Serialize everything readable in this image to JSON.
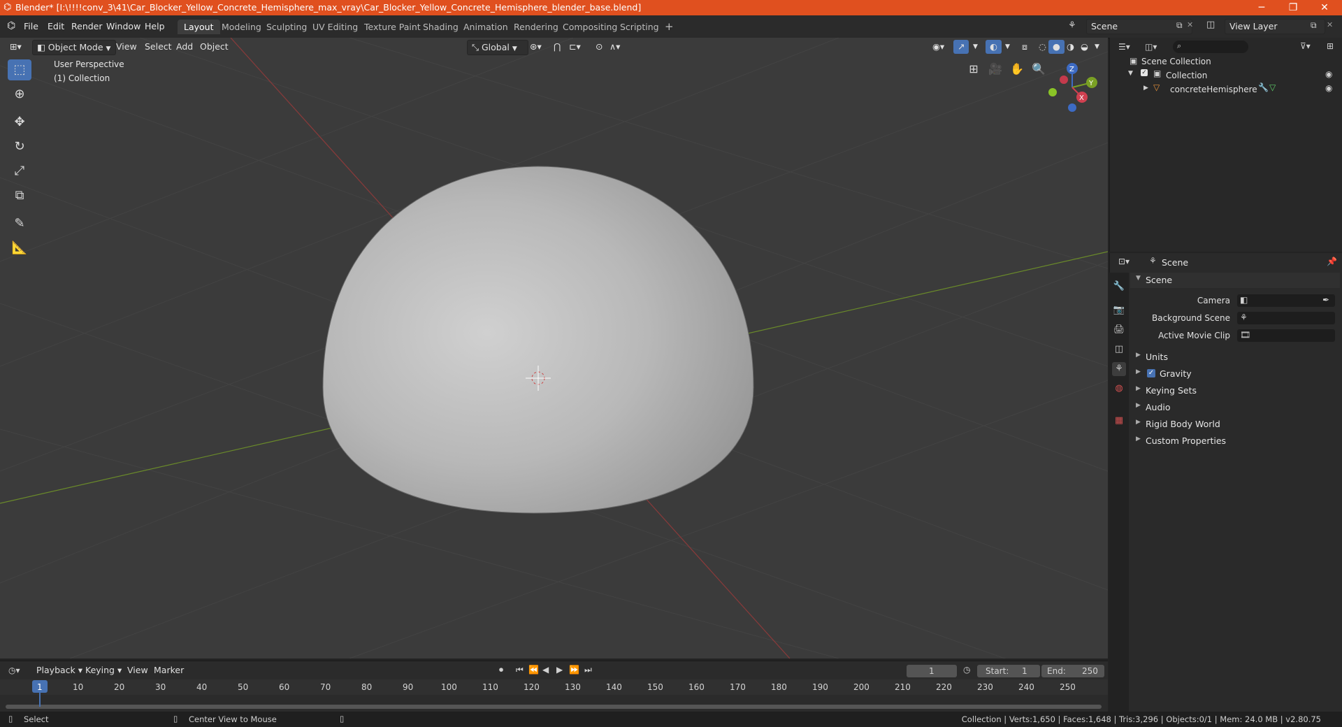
{
  "window": {
    "title": "Blender* [I:\\!!!!conv_3\\41\\Car_Blocker_Yellow_Concrete_Hemisphere_max_vray\\Car_Blocker_Yellow_Concrete_Hemisphere_blender_base.blend]",
    "minimize": "─",
    "maximize": "❐",
    "close": "✕"
  },
  "menu": [
    "File",
    "Edit",
    "Render",
    "Window",
    "Help"
  ],
  "workspaces": [
    "Layout",
    "Modeling",
    "Sculpting",
    "UV Editing",
    "Texture Paint",
    "Shading",
    "Animation",
    "Rendering",
    "Compositing",
    "Scripting"
  ],
  "add_workspace": "+",
  "scene_selector": "Scene",
  "view_layer": "View Layer",
  "viewport": {
    "mode": "Object Mode",
    "menus": [
      "View",
      "Select",
      "Add",
      "Object"
    ],
    "transform": "Global",
    "overlay_title": "User Perspective",
    "overlay_collection": "(1) Collection",
    "axes": {
      "z": "Z",
      "y": "Y",
      "x": "X"
    }
  },
  "outliner": {
    "search_placeholder": "",
    "root": "Scene Collection",
    "collection": "Collection",
    "object": "concreteHemisphere"
  },
  "properties": {
    "context": "Scene",
    "panel_scene": "Scene",
    "camera_label": "Camera",
    "background_label": "Background Scene",
    "movie_clip_label": "Active Movie Clip",
    "panels": [
      "Units",
      "Gravity",
      "Keying Sets",
      "Audio",
      "Rigid Body World",
      "Custom Properties"
    ]
  },
  "timeline": {
    "menus": [
      "Playback",
      "Keying",
      "View",
      "Marker"
    ],
    "current_frame": "1",
    "start_label": "Start:",
    "start": "1",
    "end_label": "End:",
    "end": "250",
    "ticks": [
      "1",
      "10",
      "20",
      "30",
      "40",
      "50",
      "60",
      "70",
      "80",
      "90",
      "100",
      "110",
      "120",
      "130",
      "140",
      "150",
      "160",
      "170",
      "180",
      "190",
      "200",
      "210",
      "220",
      "230",
      "240",
      "250"
    ]
  },
  "status": {
    "left": "Select",
    "middle": "Center View to Mouse",
    "right": "Collection | Verts:1,650 | Faces:1,648 | Tris:3,296 | Objects:0/1 | Mem: 24.0 MB | v2.80.75"
  },
  "colors": {
    "accent": "#4772b3",
    "titlebar": "#e0501f"
  }
}
